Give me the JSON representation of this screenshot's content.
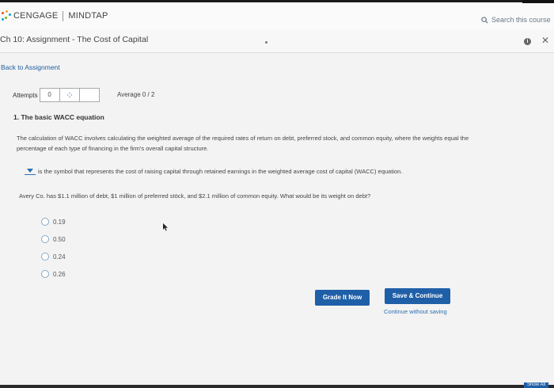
{
  "header": {
    "brand_left": "CENGAGE",
    "brand_right": "MINDTAP",
    "search_placeholder": "Search this course",
    "brand_colors": [
      "#e94e1b",
      "#f6a21e",
      "#00a3e0",
      "#7ab800"
    ]
  },
  "titlebar": {
    "title": "Ch 10: Assignment - The Cost of Capital"
  },
  "nav": {
    "back_link": "Back to Assignment"
  },
  "attempts": {
    "label": "Attempts",
    "count": "0",
    "icon": "spinner-icon",
    "average": "Average 0 / 2"
  },
  "question": {
    "title": "1. The basic WACC equation",
    "paragraph": "The calculation of WACC involves calculating the weighted average of the required rates of return on debt, preferred stock, and common equity, where the weights equal the percentage of each type of financing in the firm's overall capital structure.",
    "dropdown_sentence": "is the symbol that represents the cost of raising capital through retained earnings in the weighted average cost of capital (WACC) equation.",
    "sub_question": "Avery Co. has $1.1 million of debt, $1 million of preferred stöck, and $2.1 million of common equity. What would be its weight on debt?",
    "options": [
      "0.19",
      "0.50",
      "0.24",
      "0.26"
    ]
  },
  "actions": {
    "grade_label": "Grade It Now",
    "save_label": "Save & Continue",
    "continue_label": "Continue without saving"
  },
  "footer": {
    "show_all": "Show All"
  },
  "colors": {
    "accent": "#1f5fa8",
    "link": "#2d6fb0"
  }
}
